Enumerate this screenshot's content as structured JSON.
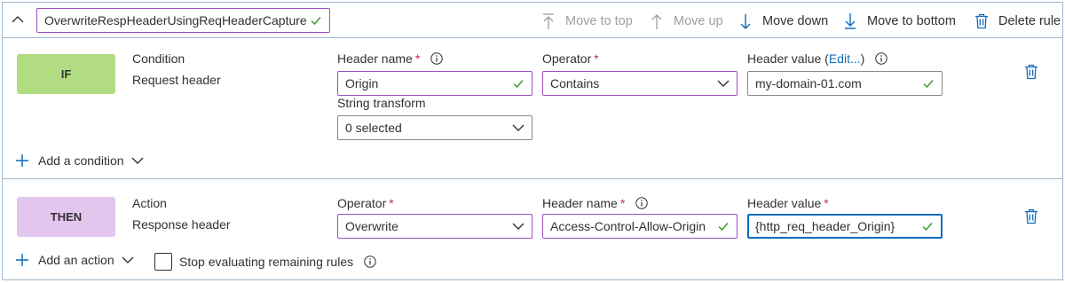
{
  "rule": {
    "name": "OverwriteRespHeaderUsingReqHeaderCapture"
  },
  "toolbar": {
    "move_to_top": "Move to top",
    "move_up": "Move up",
    "move_down": "Move down",
    "move_to_bottom": "Move to bottom",
    "delete_rule": "Delete rule"
  },
  "condition": {
    "badge": "IF",
    "title": "Condition",
    "type": "Request header",
    "header_name_label": "Header name",
    "header_name_value": "Origin",
    "operator_label": "Operator",
    "operator_value": "Contains",
    "header_value_label": "Header value",
    "header_value_edit_open": "(",
    "header_value_edit_link": "Edit...",
    "header_value_edit_close": ")",
    "header_value_value": "my-domain-01.com",
    "string_transform_label": "String transform",
    "string_transform_value": "0 selected",
    "add_condition": "Add a condition"
  },
  "action": {
    "badge": "THEN",
    "title": "Action",
    "type": "Response header",
    "operator_label": "Operator",
    "operator_value": "Overwrite",
    "header_name_label": "Header name",
    "header_name_value": "Access-Control-Allow-Origin",
    "header_value_label": "Header value",
    "header_value_value": "{http_req_header_Origin}",
    "add_action": "Add an action",
    "stop_evaluating": "Stop evaluating remaining rules"
  },
  "required_mark": "*",
  "colors": {
    "accent": "#0f6cbd",
    "if_badge": "#b1dc82",
    "then_badge": "#e3c6ee",
    "field_border": "#9b4fbf",
    "check_green": "#3f9b2f",
    "required": "#c4314b"
  }
}
